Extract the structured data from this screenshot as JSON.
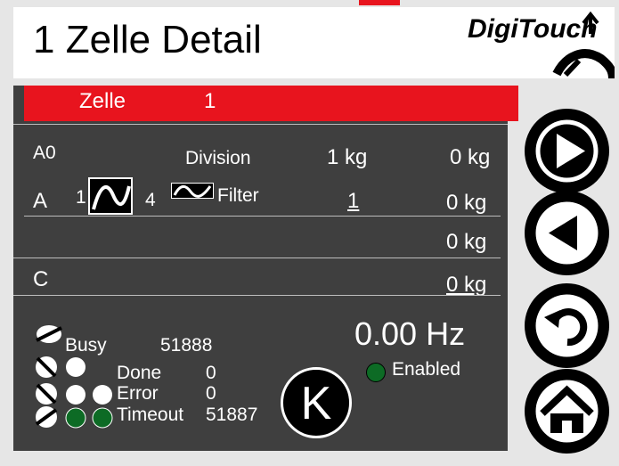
{
  "title": "1 Zelle Detail",
  "brand": "DigiTouch",
  "cell_bar": {
    "label": "Zelle",
    "number": "1"
  },
  "rows": {
    "a0": {
      "name": "A0",
      "division_label": "Division",
      "division_value": "1 kg",
      "value": "0 kg"
    },
    "a": {
      "name": "A",
      "filter_from": "1",
      "filter_to": "4",
      "filter_label": "Filter",
      "filter_value": "1",
      "value": "0 kg"
    },
    "b": {
      "value": "0 kg"
    },
    "c": {
      "name": "C",
      "value": "0 kg"
    }
  },
  "status": {
    "busy_label": "Busy",
    "busy_value": "51888",
    "done_label": "Done",
    "done_value": "0",
    "error_label": "Error",
    "error_value": "0",
    "timeout_label": "Timeout",
    "timeout_value": "51887"
  },
  "frequency": "0.00 Hz",
  "enabled_label": "Enabled",
  "k_label": "K",
  "nav": [
    "next-icon",
    "back-icon",
    "undo-icon",
    "home-icon"
  ],
  "colors": {
    "accent": "#e8141e",
    "panel": "#3f3f3f",
    "led_green": "#0d6b25"
  }
}
